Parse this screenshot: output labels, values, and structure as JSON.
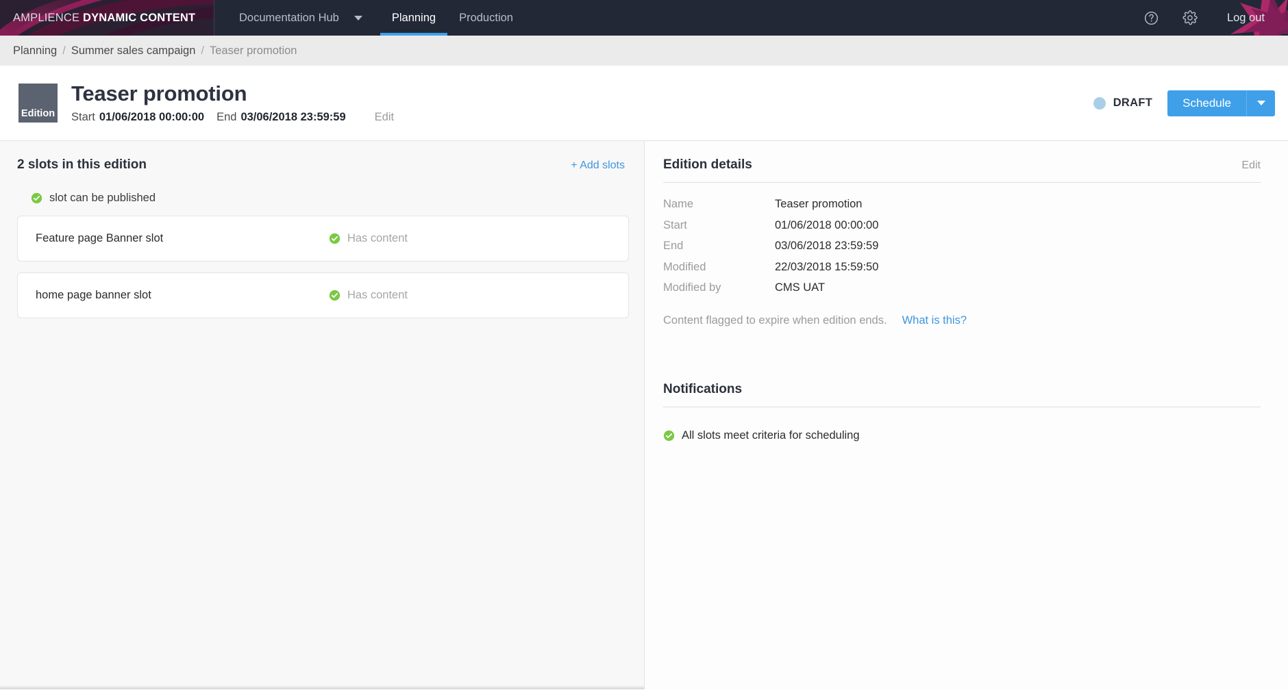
{
  "topnav": {
    "brand_light": "AMPLIENCE",
    "brand_bold": "DYNAMIC CONTENT",
    "hub_label": "Documentation Hub",
    "tab_planning": "Planning",
    "tab_production": "Production",
    "help_icon": "help-circle-icon",
    "settings_icon": "gear-icon",
    "logout_label": "Log out",
    "accent_color": "#3fa0e9",
    "bar_color": "#232836"
  },
  "breadcrumb": {
    "items": [
      {
        "label": "Planning",
        "current": false
      },
      {
        "label": "Summer sales campaign",
        "current": false
      },
      {
        "label": "Teaser promotion",
        "current": true
      }
    ],
    "separator": "/"
  },
  "page_header": {
    "badge": "Edition",
    "title": "Teaser promotion",
    "start_label": "Start",
    "start_value": "01/06/2018 00:00:00",
    "end_label": "End",
    "end_value": "03/06/2018 23:59:59",
    "edit_label": "Edit",
    "status_label": "DRAFT",
    "status_color": "#a9cfe8",
    "schedule_label": "Schedule",
    "schedule_caret_icon": "chevron-down-icon"
  },
  "left_panel": {
    "slots_title": "2 slots in this edition",
    "add_slots_label": "+ Add slots",
    "legend_icon": "check-circle-icon",
    "legend_text": "slot can be published",
    "slots": [
      {
        "name": "Feature page Banner slot",
        "status": "Has content",
        "status_icon": "check-circle-icon"
      },
      {
        "name": "home page banner slot",
        "status": "Has content",
        "status_icon": "check-circle-icon"
      }
    ]
  },
  "right_panel": {
    "details_title": "Edition details",
    "details_edit_label": "Edit",
    "details": [
      {
        "label": "Name",
        "value": "Teaser promotion"
      },
      {
        "label": "Start",
        "value": "01/06/2018 00:00:00"
      },
      {
        "label": "End",
        "value": "03/06/2018 23:59:59"
      },
      {
        "label": "Modified",
        "value": "22/03/2018 15:59:50"
      },
      {
        "label": "Modified by",
        "value": "CMS UAT"
      }
    ],
    "expire_text": "Content flagged to expire when edition ends.",
    "expire_link": "What is this?",
    "notifications_title": "Notifications",
    "notifications": [
      {
        "icon": "check-circle-icon",
        "text": "All slots meet criteria for scheduling"
      }
    ]
  }
}
